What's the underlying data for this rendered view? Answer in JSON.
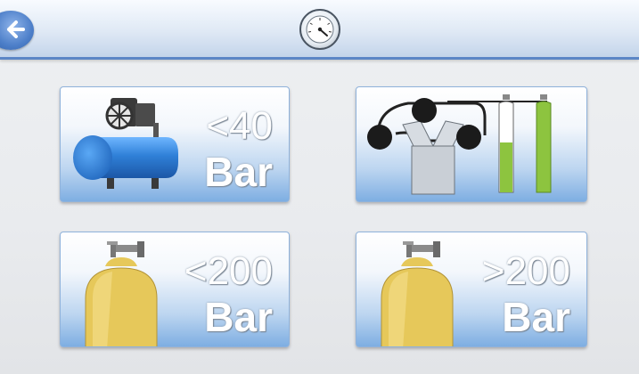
{
  "header": {
    "back_icon": "back-arrow-icon",
    "gauge_icon": "pressure-gauge-icon"
  },
  "tiles": [
    {
      "icon": "air-compressor-icon",
      "limit": "<40",
      "unit": "Bar"
    },
    {
      "icon": "compressor-filling-cylinders-icon",
      "limit": "",
      "unit": ""
    },
    {
      "icon": "scuba-cylinder-icon",
      "limit": "<200",
      "unit": "Bar"
    },
    {
      "icon": "scuba-cylinder-icon",
      "limit": ">200",
      "unit": "Bar"
    }
  ],
  "colors": {
    "header_border": "#5b86c6",
    "tile_blue": "#7eaee2",
    "cylinder_yellow": "#e6c85a",
    "cylinder_green": "#8dc43f",
    "compressor_blue": "#2f80d8"
  }
}
